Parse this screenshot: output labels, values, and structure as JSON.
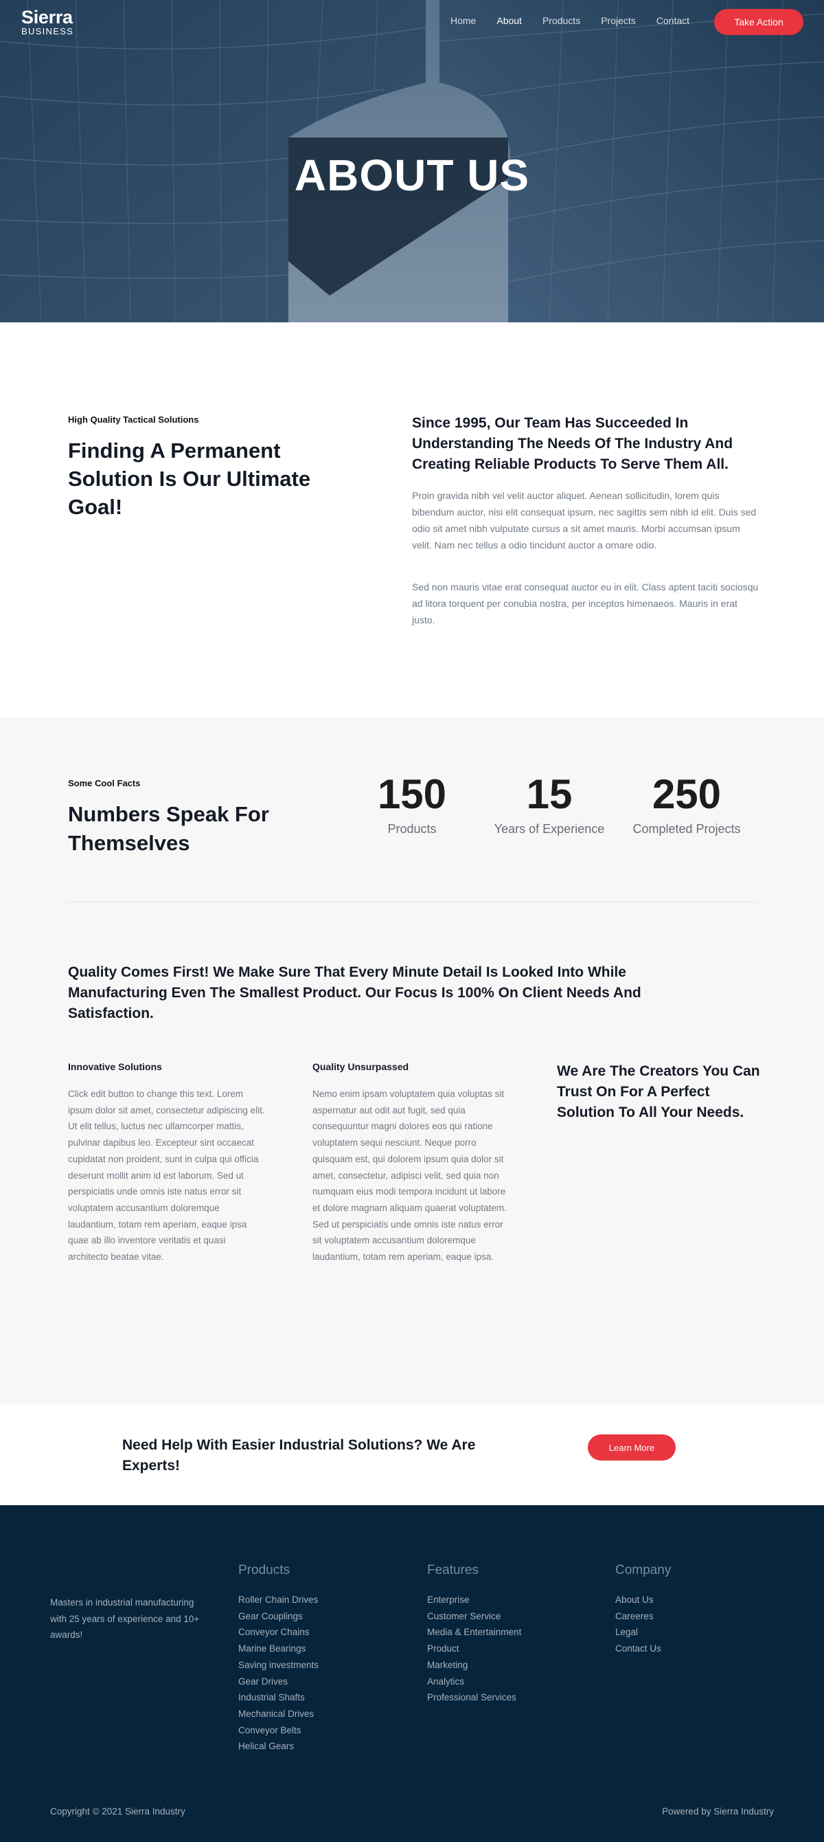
{
  "logo": {
    "name": "Sierra",
    "tagline": "BUSINESS"
  },
  "nav": {
    "items": [
      {
        "label": "Home"
      },
      {
        "label": "About"
      },
      {
        "label": "Products"
      },
      {
        "label": "Projects"
      },
      {
        "label": "Contact"
      }
    ],
    "active": "About",
    "cta_label": "Take Action"
  },
  "hero": {
    "title": "ABOUT US"
  },
  "about": {
    "eyebrow": "High Quality Tactical Solutions",
    "heading": "Finding A Permanent Solution Is Our Ultimate Goal!",
    "subheading": "Since 1995, Our Team Has Succeeded In Understanding The Needs Of The Industry And Creating Reliable Products To Serve Them All.",
    "paragraph1": "Proin gravida nibh vel velit auctor aliquet. Aenean sollicitudin, lorem quis bibendum auctor, nisi elit consequat ipsum, nec sagittis sem nibh id elit. Duis sed odio sit amet nibh vulputate cursus a sit amet mauris. Morbi accumsan ipsum velit. Nam nec tellus a odio tincidunt auctor a ornare odio.",
    "paragraph2": "Sed non mauris vitae erat consequat auctor eu in elit. Class aptent taciti sociosqu ad litora torquent per conubia nostra, per inceptos himenaeos. Mauris in erat justo."
  },
  "facts": {
    "eyebrow": "Some Cool Facts",
    "heading": "Numbers Speak For Themselves",
    "stats": [
      {
        "number": "150",
        "label": "Products"
      },
      {
        "number": "15",
        "label": "Years of Experience"
      },
      {
        "number": "250",
        "label": "Completed Projects"
      }
    ],
    "quality_heading": "Quality Comes First! We Make Sure That Every Minute Detail Is Looked Into While Manufacturing Even The Smallest Product. Our Focus Is 100% On Client Needs And Satisfaction.",
    "columns": [
      {
        "title": "Innovative Solutions",
        "text": "Click edit button to change this text. Lorem ipsum dolor sit amet, consectetur adipiscing elit. Ut elit tellus, luctus nec ullamcorper mattis, pulvinar dapibus leo. Excepteur sint occaecat cupidatat non proident, sunt in culpa qui officia deserunt mollit anim id est laborum. Sed ut perspiciatis unde omnis iste natus error sit voluptatem accusantium doloremque laudantium, totam rem aperiam, eaque ipsa quae ab illo inventore veritatis et quasi architecto beatae vitae."
      },
      {
        "title": "Quality Unsurpassed",
        "text": "Nemo enim ipsam voluptatem quia voluptas sit aspernatur aut odit aut fugit, sed quia consequuntur magni dolores eos qui ratione voluptatem sequi nesciunt. Neque porro quisquam est, qui dolorem ipsum quia dolor sit amet, consectetur, adipisci velit, sed quia non numquam eius modi tempora incidunt ut labore et dolore magnam aliquam quaerat voluptatem. Sed ut perspiciatis unde omnis iste natus error sit voluptatem accusantium doloremque laudantium, totam rem aperiam, eaque ipsa."
      }
    ],
    "creators_heading": "We Are The Creators You Can Trust On For A Perfect Solution To All Your Needs."
  },
  "cta_band": {
    "text": "Need Help With Easier Industrial Solutions? We Are Experts!",
    "button_label": "Learn More"
  },
  "footer": {
    "tagline": "Masters in industrial manufacturing with 25 years of experience and 10+ awards!",
    "columns": [
      {
        "heading": "Products",
        "items": [
          "Roller Chain Drives",
          "Gear Couplings",
          "Conveyor Chains",
          "Marine Bearings",
          "Saving investments",
          "Gear Drives",
          "Industrial Shafts",
          "Mechanical Drives",
          "Conveyor Belts",
          "Helical Gears"
        ]
      },
      {
        "heading": "Features",
        "items": [
          "Enterprise",
          "Customer Service",
          "Media & Entertainment",
          "Product",
          "Marketing",
          "Analytics",
          "Professional Services"
        ]
      },
      {
        "heading": "Company",
        "items": [
          "About Us",
          "Careeres",
          "Legal",
          "Contact Us"
        ]
      }
    ],
    "copyright": "Copyright © 2021 Sierra Industry",
    "powered_by": "Powered by Sierra Industry"
  },
  "colors": {
    "accent": "#e8353f",
    "footer_bg": "#06243b",
    "facts_bg": "#f8f7f7",
    "heading": "#141a26",
    "body_text": "#707a86"
  }
}
